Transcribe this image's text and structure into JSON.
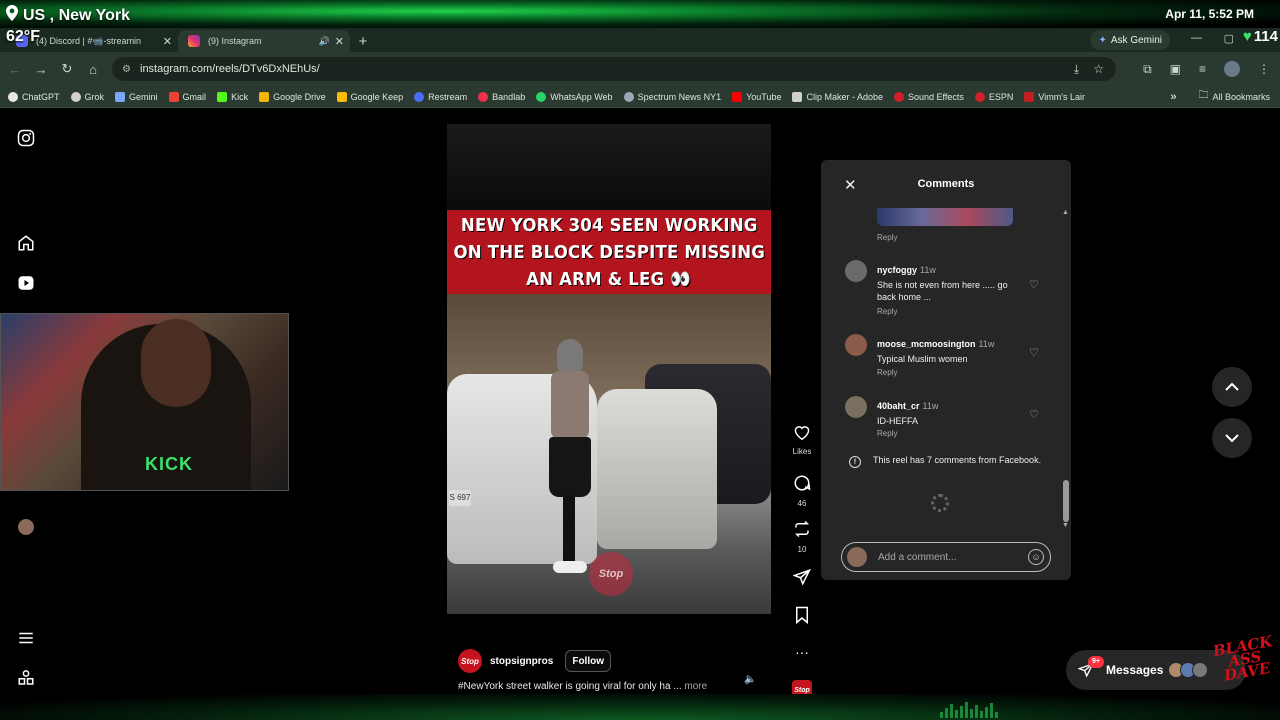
{
  "overlay": {
    "location": "US , New York",
    "temperature": "62°F",
    "datetime": "Apr 11, 5:52 PM",
    "heart_rate": "114",
    "watermark": "BLACK ASS DAVE"
  },
  "browser": {
    "tabs": [
      {
        "label": "(4) Discord | #📹-streamin",
        "active": false
      },
      {
        "label": "(9) Instagram",
        "active": true
      }
    ],
    "ask_gemini": "Ask Gemini",
    "url": "instagram.com/reels/DTv6DxNEhUs/",
    "bookmarks": [
      {
        "label": "ChatGPT",
        "color": "#e8e8e8"
      },
      {
        "label": "Grok",
        "color": "#d0d0d0"
      },
      {
        "label": "Gemini",
        "color": "#7aa6ff"
      },
      {
        "label": "Gmail",
        "color": "#ea4335"
      },
      {
        "label": "Kick",
        "color": "#53fc18"
      },
      {
        "label": "Google Drive",
        "color": "#f4b400"
      },
      {
        "label": "Google Keep",
        "color": "#fbbc04"
      },
      {
        "label": "Restream",
        "color": "#4a6cf7"
      },
      {
        "label": "Bandlab",
        "color": "#f0314a"
      },
      {
        "label": "WhatsApp Web",
        "color": "#25d366"
      },
      {
        "label": "Spectrum News NY1",
        "color": "#9aa8b8"
      },
      {
        "label": "YouTube",
        "color": "#ff0000"
      },
      {
        "label": "Clip Maker - Adobe",
        "color": "#d0d0d0"
      },
      {
        "label": "Sound Effects",
        "color": "#d0202a"
      },
      {
        "label": "ESPN",
        "color": "#d0202a"
      },
      {
        "label": "Vimm's Lair",
        "color": "#c02020"
      }
    ],
    "all_bookmarks": "All Bookmarks"
  },
  "reel": {
    "headline": [
      "NEW YORK 304 SEEN WORKING",
      "ON THE BLOCK DESPITE MISSING",
      "AN ARM & LEG 👀"
    ],
    "watermark": "Stop",
    "plate": "S 697",
    "author": "stopsignpros",
    "author_logo": "Stop",
    "follow_label": "Follow",
    "caption": "#NewYork street walker is going viral for only ha ...",
    "more_label": "more",
    "likes_label": "Likes",
    "comments_count": "46",
    "reposts_count": "10"
  },
  "comments_panel": {
    "title": "Comments",
    "reply_label": "Reply",
    "comments": [
      {
        "user": "nycfoggy",
        "time": "11w",
        "text": "She is not even from here ..... go back home ...",
        "avatar_color": "#6a6a6a"
      },
      {
        "user": "moose_mcmoosington",
        "time": "11w",
        "text": "Typical Muslim women",
        "avatar_color": "#8a5a4a"
      },
      {
        "user": "40baht_cr",
        "time": "11w",
        "text": "ID-HEFFA",
        "avatar_color": "#7a7060"
      }
    ],
    "facebook_note": "This reel has 7 comments from Facebook.",
    "input_placeholder": "Add a comment..."
  },
  "messages": {
    "label": "Messages",
    "badge": "9+"
  }
}
